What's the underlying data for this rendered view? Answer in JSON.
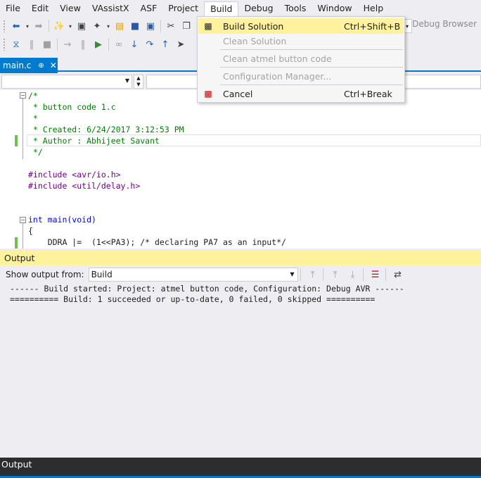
{
  "menubar": {
    "items": [
      "File",
      "Edit",
      "View",
      "VAssistX",
      "ASF",
      "Project",
      "Build",
      "Debug",
      "Tools",
      "Window",
      "Help"
    ]
  },
  "toolbar": {
    "debug_browser": "Debug Browser"
  },
  "tab": {
    "title": "main.c",
    "pin_icon": "pin-icon",
    "close_icon": "close-icon"
  },
  "editor": {
    "lines": [
      "/*",
      " * button code 1.c",
      " *",
      " * Created: 6/24/2017 3:12:53 PM",
      " * Author : Abhijeet Savant",
      " */",
      "",
      "#include <avr/io.h>",
      "#include <util/delay.h>",
      "",
      "",
      "int main(void)",
      "{",
      "    DDRA |=  (1<<PA3); /* declaring PA7 as an input*/"
    ]
  },
  "build_menu": {
    "items": [
      {
        "label": "Build Solution",
        "shortcut": "Ctrl+Shift+B",
        "icon": "build-icon",
        "enabled": true
      },
      {
        "label": "Clean Solution",
        "shortcut": "",
        "icon": "",
        "enabled": false
      },
      {
        "label": "Clean atmel button code",
        "shortcut": "",
        "icon": "",
        "enabled": false
      },
      {
        "label": "Configuration Manager...",
        "shortcut": "",
        "icon": "",
        "enabled": false
      },
      {
        "label": "Cancel",
        "shortcut": "Ctrl+Break",
        "icon": "cancel-build-icon",
        "enabled": true
      }
    ]
  },
  "output": {
    "header": "Output",
    "show_from_label": "Show output from:",
    "source": "Build",
    "lines": [
      "------ Build started: Project: atmel button code, Configuration: Debug AVR ------",
      "========== Build: 1 succeeded or up-to-date, 0 failed, 0 skipped =========="
    ],
    "bottom_tab": "Output"
  },
  "colors": {
    "accent": "#007acc",
    "highlight": "#fff29d",
    "comment": "#008000",
    "keyword": "#0000ff"
  }
}
